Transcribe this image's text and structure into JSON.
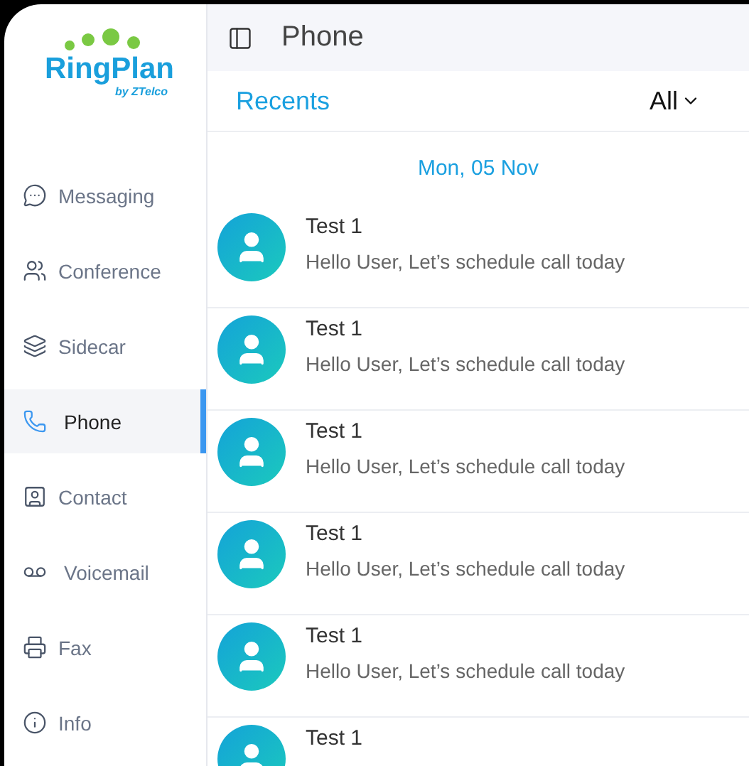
{
  "logo": {
    "name": "RingPlan",
    "tagline": "by ZTelco"
  },
  "sidebar": {
    "items": [
      {
        "label": "Messaging",
        "kind": "messaging",
        "selected": false
      },
      {
        "label": "Conference",
        "kind": "conference",
        "selected": false
      },
      {
        "label": "Sidecar",
        "kind": "sidecar",
        "selected": false
      },
      {
        "label": "Phone",
        "kind": "phone",
        "selected": true
      },
      {
        "label": "Contact",
        "kind": "contact",
        "selected": false
      },
      {
        "label": "Voicemail",
        "kind": "voicemail",
        "selected": false
      },
      {
        "label": "Fax",
        "kind": "fax",
        "selected": false
      },
      {
        "label": "Info",
        "kind": "info",
        "selected": false
      }
    ]
  },
  "header": {
    "title": "Phone"
  },
  "recents": {
    "title": "Recents",
    "filter": "All",
    "date": "Mon, 05 Nov",
    "items": [
      {
        "name": "Test 1",
        "message": "Hello User, Let’s schedule call today"
      },
      {
        "name": "Test 1",
        "message": "Hello User, Let’s schedule call today"
      },
      {
        "name": "Test 1",
        "message": "Hello User, Let’s schedule call today"
      },
      {
        "name": "Test 1",
        "message": "Hello User, Let’s schedule call today"
      },
      {
        "name": "Test 1",
        "message": "Hello User, Let’s schedule call today"
      },
      {
        "name": "Test 1"
      }
    ]
  }
}
